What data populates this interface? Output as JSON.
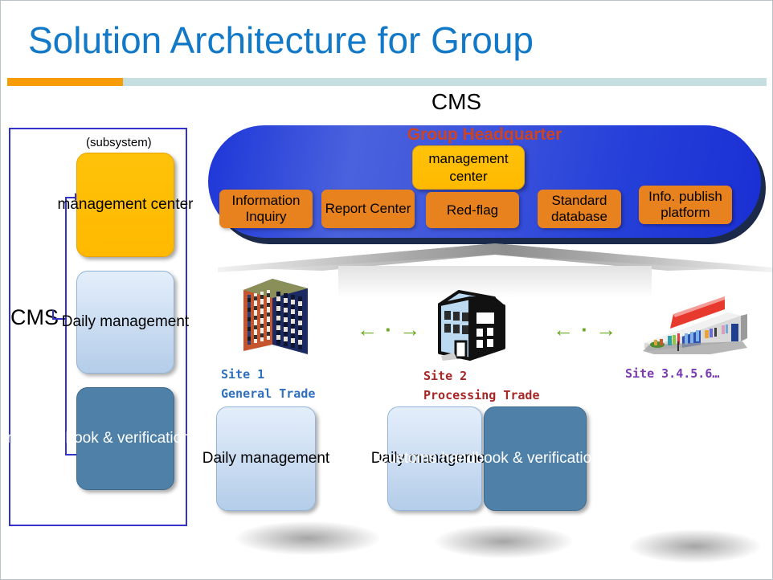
{
  "slide": {
    "title": "Solution Architecture for Group",
    "accent_orange": "#f79b07",
    "accent_teal": "#c5dee0",
    "title_color": "#1278c8"
  },
  "cms_heading": "CMS",
  "left_panel": {
    "label": "CMS",
    "caption": "(subsystem)",
    "boxes": [
      {
        "label": "management center",
        "color": "#ffc00a"
      },
      {
        "label": "Daily management",
        "color": "#b4cde9"
      },
      {
        "label": "Customs handbook & verification management",
        "color": "#4f81a8"
      }
    ]
  },
  "headquarter": {
    "title": "Group Headquarter",
    "title_color": "#cf4420",
    "banner_color": "#2540d9",
    "management_center": "management center",
    "modules": [
      {
        "label": "Information Inquiry"
      },
      {
        "label": "Report Center"
      },
      {
        "label": "Red-flag"
      },
      {
        "label": "Standard database"
      },
      {
        "label": "Info. publish platform"
      }
    ],
    "module_color": "#e8821e"
  },
  "sites": [
    {
      "name": "Site 1",
      "type": "General Trade",
      "color": "#2f6fbd",
      "icon": "apartment-building-icon",
      "boxes": [
        {
          "label": "Daily management",
          "color": "#b4cde9"
        }
      ]
    },
    {
      "name": "Site 2",
      "type": "Processing Trade",
      "color": "#a62626",
      "icon": "office-building-icon",
      "boxes": [
        {
          "label": "Daily management",
          "color": "#b4cde9"
        },
        {
          "label": "Customs handbook & verification management",
          "color": "#4f81a8"
        }
      ]
    },
    {
      "name": "Site 3.4.5.6…",
      "type": "",
      "color": "#7a3bb5",
      "icon": "retail-store-icon",
      "boxes": []
    }
  ],
  "connectors": {
    "site_link_glyph": "← · →",
    "site_link_color": "#67a81f"
  }
}
